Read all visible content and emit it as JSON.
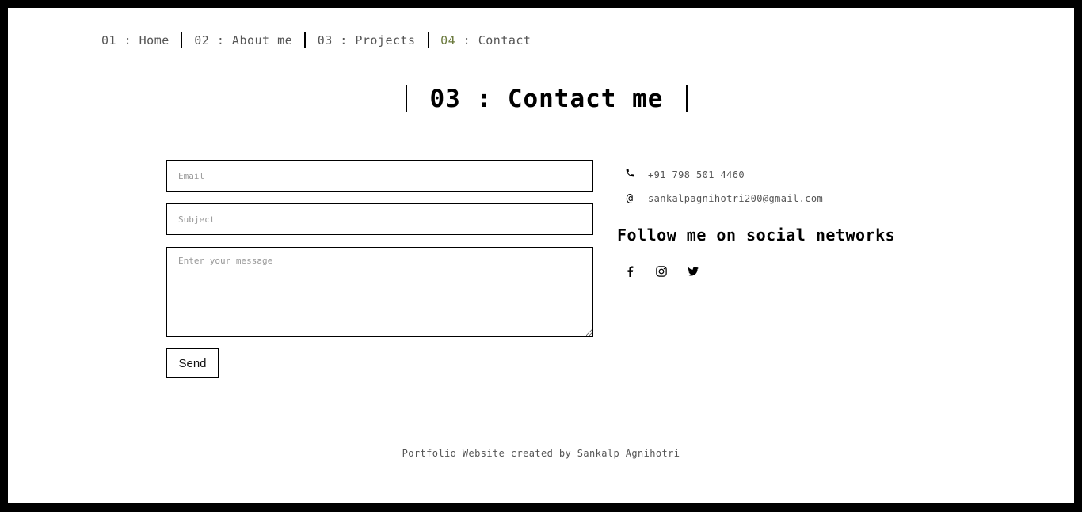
{
  "nav": {
    "items": [
      {
        "num": "01",
        "label": " : Home"
      },
      {
        "num": "02",
        "label": " : About me"
      },
      {
        "num": "03",
        "label": " : Projects"
      },
      {
        "num": "04",
        "label": " : Contact"
      }
    ]
  },
  "page_title": "03 : Contact me",
  "form": {
    "email_placeholder": "Email",
    "subject_placeholder": "Subject",
    "message_placeholder": "Enter your message",
    "send_label": "Send"
  },
  "contact": {
    "phone": "+91 798 501 4460",
    "email": "sankalpagnihotri200@gmail.com",
    "phone_icon": "phone-icon",
    "email_icon": "at-icon"
  },
  "social": {
    "heading": "Follow me on social networks",
    "icons": [
      "facebook-icon",
      "instagram-icon",
      "twitter-icon"
    ]
  },
  "footer": "Portfolio Website created by Sankalp Agnihotri",
  "colors": {
    "border": "#000000",
    "text_muted": "#555555",
    "active_num": "#6b7a3e"
  }
}
